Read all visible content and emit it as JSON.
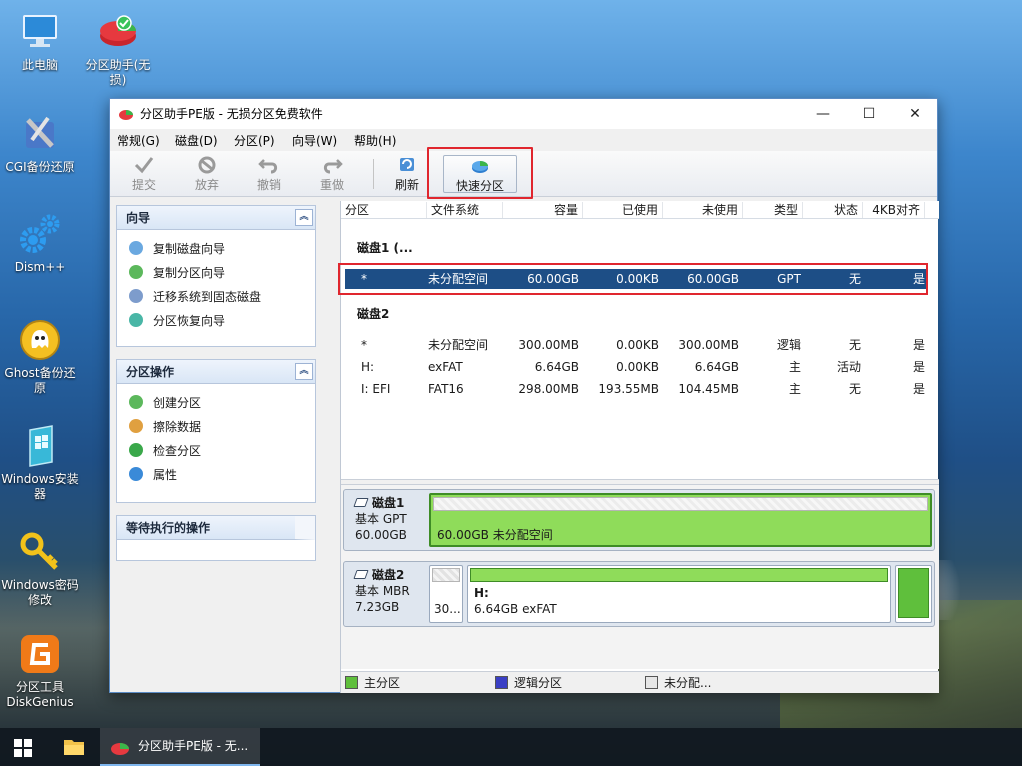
{
  "desktop": {
    "icons": [
      {
        "label": "此电脑",
        "icon": "computer-icon"
      },
      {
        "label": "分区助手(无损)",
        "icon": "partition-assistant-icon"
      },
      {
        "label": "CGI备份还原",
        "icon": "cgi-tools-icon"
      },
      {
        "label": "Dism++",
        "icon": "gears-icon"
      },
      {
        "label": "Ghost备份还原",
        "icon": "ghost-icon"
      },
      {
        "label": "Windows安装器",
        "icon": "windows-installer-icon"
      },
      {
        "label": "Windows密码修改",
        "icon": "key-icon"
      },
      {
        "label": "分区工具DiskGenius",
        "icon": "diskgenius-icon"
      }
    ]
  },
  "taskbar": {
    "app_label": "分区助手PE版 - 无..."
  },
  "window": {
    "title": "分区助手PE版 - 无损分区免费软件",
    "controls": {
      "minimize": "—",
      "maximize": "☐",
      "close": "✕"
    },
    "menu": [
      "常规(G)",
      "磁盘(D)",
      "分区(P)",
      "向导(W)",
      "帮助(H)"
    ],
    "toolbar": [
      {
        "label": "提交",
        "icon": "checkmark-icon",
        "enabled": false
      },
      {
        "label": "放弃",
        "icon": "discard-icon",
        "enabled": false
      },
      {
        "label": "撤销",
        "icon": "undo-icon",
        "enabled": false
      },
      {
        "label": "重做",
        "icon": "redo-icon",
        "enabled": false
      },
      {
        "label": "刷新",
        "icon": "refresh-icon",
        "enabled": true
      },
      {
        "label": "快速分区",
        "icon": "quick-partition-icon",
        "enabled": true
      }
    ],
    "highlight_color": "#e0262e"
  },
  "left_panel": {
    "wizard": {
      "title": "向导",
      "items": [
        "复制磁盘向导",
        "复制分区向导",
        "迁移系统到固态磁盘",
        "分区恢复向导"
      ]
    },
    "partition_ops": {
      "title": "分区操作",
      "items": [
        "创建分区",
        "擦除数据",
        "检查分区",
        "属性"
      ]
    },
    "pending": {
      "title": "等待执行的操作"
    },
    "collapse_glyph": "︽"
  },
  "partition_list": {
    "columns": [
      "分区",
      "文件系统",
      "容量",
      "已使用",
      "未使用",
      "类型",
      "状态",
      "4KB对齐"
    ],
    "disk1": {
      "label": "磁盘1 (...",
      "rows": [
        {
          "partition": "*",
          "fs": "未分配空间",
          "capacity": "60.00GB",
          "used": "0.00KB",
          "free": "60.00GB",
          "type": "GPT",
          "status": "无",
          "align": "是"
        }
      ]
    },
    "disk2": {
      "label": "磁盘2",
      "rows": [
        {
          "partition": "*",
          "fs": "未分配空间",
          "capacity": "300.00MB",
          "used": "0.00KB",
          "free": "300.00MB",
          "type": "逻辑",
          "status": "无",
          "align": "是"
        },
        {
          "partition": "H:",
          "fs": "exFAT",
          "capacity": "6.64GB",
          "used": "0.00KB",
          "free": "6.64GB",
          "type": "主",
          "status": "活动",
          "align": "是"
        },
        {
          "partition": "I: EFI",
          "fs": "FAT16",
          "capacity": "298.00MB",
          "used": "193.55MB",
          "free": "104.45MB",
          "type": "主",
          "status": "无",
          "align": "是"
        }
      ]
    },
    "selected_color": "#1d4e86"
  },
  "disk_map": {
    "disk1": {
      "name": "磁盘1",
      "style": "基本 GPT",
      "size": "60.00GB",
      "segment_text": "60.00GB 未分配空间"
    },
    "disk2": {
      "name": "磁盘2",
      "style": "基本 MBR",
      "size": "7.23GB",
      "seg1_text": "30...",
      "seg2_title": "H:",
      "seg2_text": "6.64GB exFAT"
    },
    "colors": {
      "primary": "#5fbf3c",
      "logical": "#3a3fc4",
      "unallocated": "#e6e6e6",
      "selected_fill": "#8fdc5a"
    }
  },
  "legend": {
    "primary": "主分区",
    "logical": "逻辑分区",
    "unallocated": "未分配..."
  }
}
